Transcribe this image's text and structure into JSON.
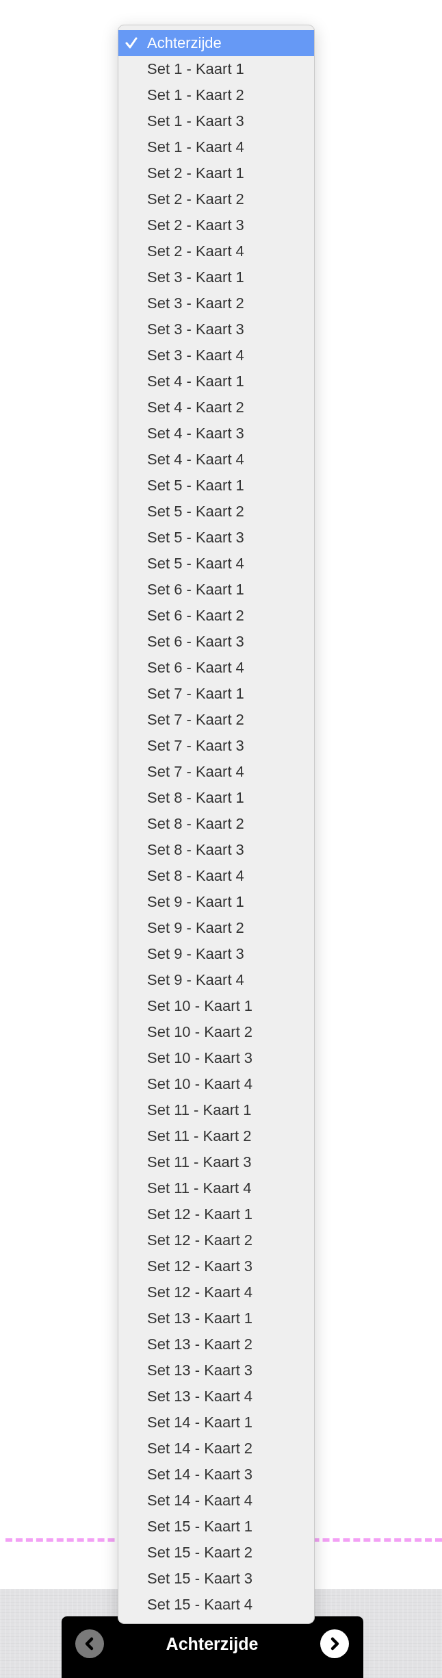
{
  "menu": {
    "items": [
      {
        "label": "Achterzijde",
        "selected": true
      },
      {
        "label": "Set 1 - Kaart 1",
        "selected": false
      },
      {
        "label": "Set 1 - Kaart 2",
        "selected": false
      },
      {
        "label": "Set 1 - Kaart 3",
        "selected": false
      },
      {
        "label": "Set 1 - Kaart 4",
        "selected": false
      },
      {
        "label": "Set 2 - Kaart 1",
        "selected": false
      },
      {
        "label": "Set 2 - Kaart 2",
        "selected": false
      },
      {
        "label": "Set 2 - Kaart 3",
        "selected": false
      },
      {
        "label": "Set 2 - Kaart 4",
        "selected": false
      },
      {
        "label": "Set 3 - Kaart 1",
        "selected": false
      },
      {
        "label": "Set 3 - Kaart 2",
        "selected": false
      },
      {
        "label": "Set 3 - Kaart 3",
        "selected": false
      },
      {
        "label": "Set 3 - Kaart 4",
        "selected": false
      },
      {
        "label": "Set 4 - Kaart 1",
        "selected": false
      },
      {
        "label": "Set 4 - Kaart 2",
        "selected": false
      },
      {
        "label": "Set 4 - Kaart 3",
        "selected": false
      },
      {
        "label": "Set 4 - Kaart 4",
        "selected": false
      },
      {
        "label": "Set 5 - Kaart 1",
        "selected": false
      },
      {
        "label": "Set 5 - Kaart 2",
        "selected": false
      },
      {
        "label": "Set 5 - Kaart 3",
        "selected": false
      },
      {
        "label": "Set 5 - Kaart 4",
        "selected": false
      },
      {
        "label": "Set 6 - Kaart 1",
        "selected": false
      },
      {
        "label": "Set 6 - Kaart 2",
        "selected": false
      },
      {
        "label": "Set 6 - Kaart 3",
        "selected": false
      },
      {
        "label": "Set 6 - Kaart 4",
        "selected": false
      },
      {
        "label": "Set 7 - Kaart 1",
        "selected": false
      },
      {
        "label": "Set 7 - Kaart 2",
        "selected": false
      },
      {
        "label": "Set 7 - Kaart 3",
        "selected": false
      },
      {
        "label": "Set 7 - Kaart 4",
        "selected": false
      },
      {
        "label": "Set 8 - Kaart 1",
        "selected": false
      },
      {
        "label": "Set 8 - Kaart 2",
        "selected": false
      },
      {
        "label": "Set 8 - Kaart 3",
        "selected": false
      },
      {
        "label": "Set 8 - Kaart 4",
        "selected": false
      },
      {
        "label": "Set 9 - Kaart 1",
        "selected": false
      },
      {
        "label": "Set 9 - Kaart 2",
        "selected": false
      },
      {
        "label": "Set 9 - Kaart 3",
        "selected": false
      },
      {
        "label": "Set 9 - Kaart 4",
        "selected": false
      },
      {
        "label": "Set 10 - Kaart 1",
        "selected": false
      },
      {
        "label": "Set 10 - Kaart 2",
        "selected": false
      },
      {
        "label": "Set 10 - Kaart 3",
        "selected": false
      },
      {
        "label": "Set 10 - Kaart 4",
        "selected": false
      },
      {
        "label": "Set 11 - Kaart 1",
        "selected": false
      },
      {
        "label": "Set 11 - Kaart 2",
        "selected": false
      },
      {
        "label": "Set 11 - Kaart 3",
        "selected": false
      },
      {
        "label": "Set 11 - Kaart 4",
        "selected": false
      },
      {
        "label": "Set 12 - Kaart 1",
        "selected": false
      },
      {
        "label": "Set 12 - Kaart 2",
        "selected": false
      },
      {
        "label": "Set 12 - Kaart 3",
        "selected": false
      },
      {
        "label": "Set 12 - Kaart 4",
        "selected": false
      },
      {
        "label": "Set 13 - Kaart 1",
        "selected": false
      },
      {
        "label": "Set 13 - Kaart 2",
        "selected": false
      },
      {
        "label": "Set 13 - Kaart 3",
        "selected": false
      },
      {
        "label": "Set 13 - Kaart 4",
        "selected": false
      },
      {
        "label": "Set 14 - Kaart 1",
        "selected": false
      },
      {
        "label": "Set 14 - Kaart 2",
        "selected": false
      },
      {
        "label": "Set 14 - Kaart 3",
        "selected": false
      },
      {
        "label": "Set 14 - Kaart 4",
        "selected": false
      },
      {
        "label": "Set 15 - Kaart 1",
        "selected": false
      },
      {
        "label": "Set 15 - Kaart 2",
        "selected": false
      },
      {
        "label": "Set 15 - Kaart 3",
        "selected": false
      },
      {
        "label": "Set 15 - Kaart 4",
        "selected": false
      }
    ]
  },
  "navigator": {
    "title": "Achterzijde",
    "previous": {
      "disabled": true
    },
    "next": {
      "disabled": false
    }
  }
}
